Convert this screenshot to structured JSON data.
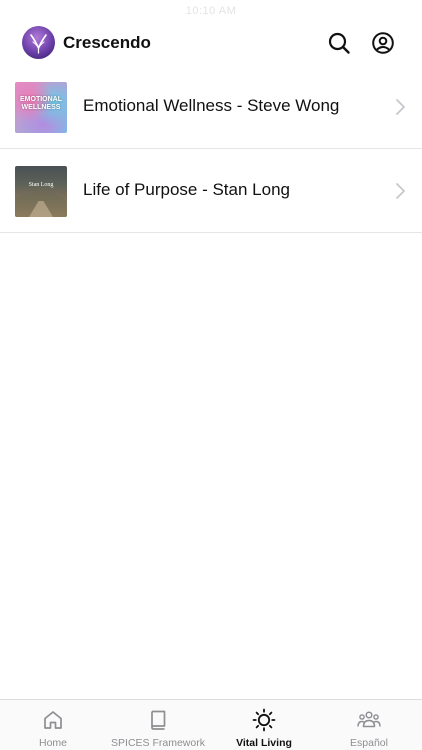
{
  "status_bar": {
    "time": "10:10 AM"
  },
  "header": {
    "app_name": "Crescendo",
    "logo_icon": "crescendo-logo-icon",
    "actions": [
      {
        "name": "search",
        "icon": "search-icon"
      },
      {
        "name": "account",
        "icon": "account-circle-icon"
      }
    ]
  },
  "list": {
    "items": [
      {
        "title": "Emotional Wellness - Steve Wong",
        "thumbnail_text": "EMOTIONAL WELLNESS",
        "thumbnail_icon": "emotional-wellness-thumbnail"
      },
      {
        "title": "Life of Purpose - Stan Long",
        "thumbnail_text": "Stan Long",
        "thumbnail_icon": "life-of-purpose-thumbnail"
      }
    ]
  },
  "tabbar": {
    "tabs": [
      {
        "label": "Home",
        "icon": "home-icon",
        "active": false
      },
      {
        "label": "SPICES Framework",
        "icon": "book-icon",
        "active": false
      },
      {
        "label": "Vital Living",
        "icon": "sun-icon",
        "active": true
      },
      {
        "label": "Español",
        "icon": "group-icon",
        "active": false
      }
    ]
  },
  "colors": {
    "active_tab": "#111111",
    "inactive_tab": "#8e8e93",
    "divider": "#e6e6e6",
    "chevron": "#c7c7cc"
  }
}
